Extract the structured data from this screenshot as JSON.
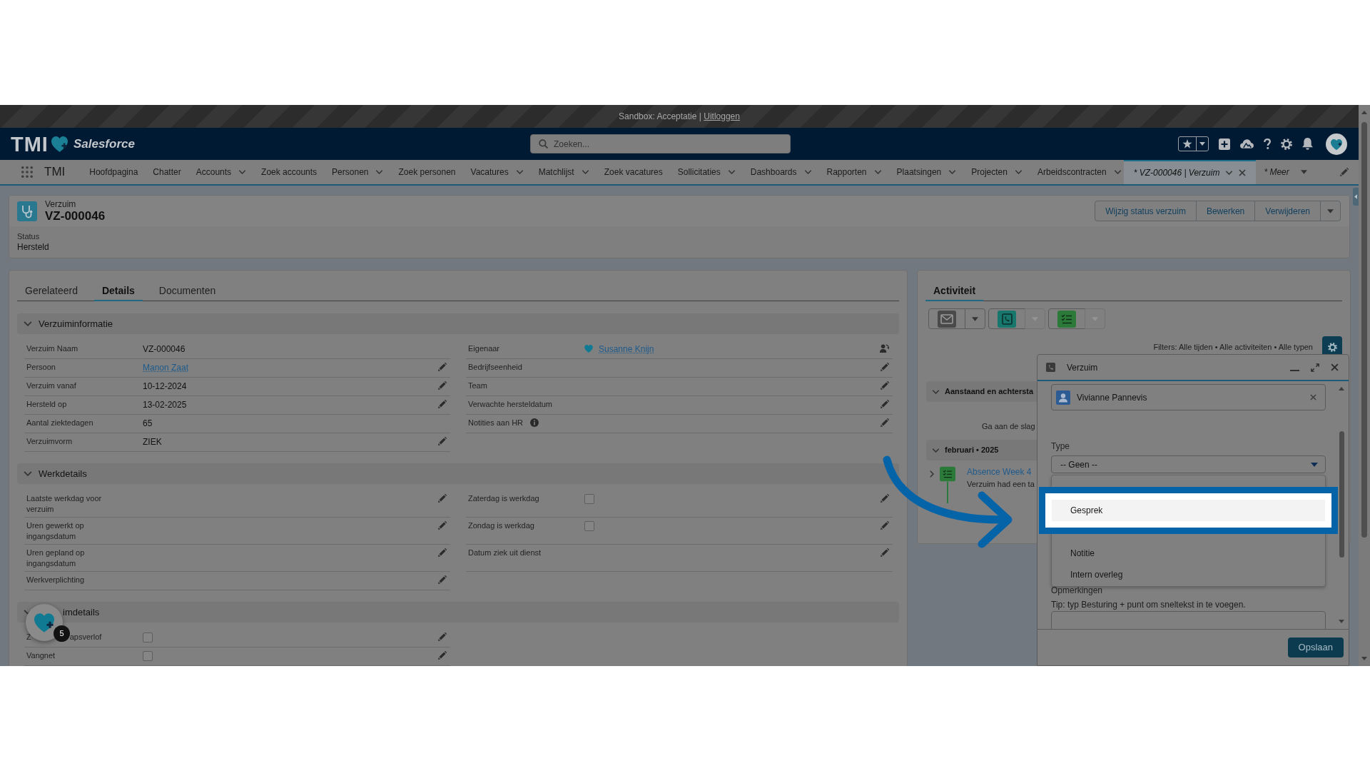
{
  "sandbox_bar": {
    "text": "Sandbox: Acceptatie |",
    "link": "Uitloggen"
  },
  "header": {
    "logo": "TMI",
    "product": "Salesforce",
    "search": {
      "placeholder": "Zoeken..."
    }
  },
  "nav": {
    "app_name": "TMI",
    "items": [
      {
        "label": "Hoofdpagina",
        "kind": "app",
        "dropdown": false,
        "selected": false
      },
      {
        "label": "Chatter",
        "kind": "app",
        "dropdown": false,
        "selected": false
      },
      {
        "label": "Accounts",
        "kind": "app",
        "dropdown": true,
        "selected": false
      },
      {
        "label": "Zoek accounts",
        "kind": "app",
        "dropdown": false,
        "selected": false
      },
      {
        "label": "Personen",
        "kind": "app",
        "dropdown": true,
        "selected": false
      },
      {
        "label": "Zoek personen",
        "kind": "app",
        "dropdown": false,
        "selected": false
      },
      {
        "label": "Vacatures",
        "kind": "app",
        "dropdown": true,
        "selected": false
      },
      {
        "label": "Matchlijst",
        "kind": "app",
        "dropdown": true,
        "selected": false
      },
      {
        "label": "Zoek vacatures",
        "kind": "app",
        "dropdown": false,
        "selected": false
      },
      {
        "label": "Sollicitaties",
        "kind": "app",
        "dropdown": true,
        "selected": false
      },
      {
        "label": "Dashboards",
        "kind": "app",
        "dropdown": true,
        "selected": false
      },
      {
        "label": "Rapporten",
        "kind": "app",
        "dropdown": true,
        "selected": false
      },
      {
        "label": "Plaatsingen",
        "kind": "app",
        "dropdown": true,
        "selected": false
      },
      {
        "label": "Projecten",
        "kind": "app",
        "dropdown": true,
        "selected": false
      },
      {
        "label": "Arbeidscontracten",
        "kind": "app",
        "dropdown": true,
        "selected": false
      },
      {
        "label": "* VZ-000046 | Verzuim",
        "kind": "record",
        "dropdown": true,
        "selected": true
      },
      {
        "label": "* Meer",
        "kind": "more",
        "dropdown": true,
        "selected": false
      }
    ]
  },
  "record": {
    "object": "Verzuim",
    "name": "VZ-000046",
    "actions": [
      "Wijzig status verzuim",
      "Bewerken",
      "Verwijderen"
    ],
    "highlights": [
      {
        "label": "Status",
        "value": "Hersteld"
      }
    ]
  },
  "detail_tabs": [
    {
      "label": "Gerelateerd",
      "selected": false
    },
    {
      "label": "Details",
      "selected": true
    },
    {
      "label": "Documenten",
      "selected": false
    }
  ],
  "sections": [
    {
      "title": "Verzuiminformatie",
      "expanded": true,
      "covered": false,
      "left": [
        {
          "label": "Verzuim Naam",
          "kind": "text",
          "value": "VZ-000046",
          "editable": false,
          "help": false
        },
        {
          "label": "Persoon",
          "kind": "link",
          "value": "Manon Zaat",
          "editable": true,
          "help": false
        },
        {
          "label": "Verzuim vanaf",
          "kind": "text",
          "value": "10-12-2024",
          "editable": true,
          "help": false
        },
        {
          "label": "Hersteld op",
          "kind": "text",
          "value": "13-02-2025",
          "editable": true,
          "help": false
        },
        {
          "label": "Aantal ziektedagen",
          "kind": "text",
          "value": "65",
          "editable": false,
          "help": false
        },
        {
          "label": "Verzuimvorm",
          "kind": "text",
          "value": "ZIEK",
          "editable": true,
          "help": false
        }
      ],
      "right": [
        {
          "label": "Eigenaar",
          "kind": "owner",
          "value": "Susanne Knijn",
          "editable": true,
          "help": false
        },
        {
          "label": "Bedrijfseenheid",
          "kind": "text",
          "editable": true,
          "help": false
        },
        {
          "label": "Team",
          "kind": "text",
          "editable": true,
          "help": false
        },
        {
          "label": "Verwachte hersteldatum",
          "kind": "text",
          "editable": true,
          "help": false
        },
        {
          "label": "Notities aan HR",
          "kind": "text",
          "editable": true,
          "help": true
        }
      ]
    },
    {
      "title": "Werkdetails",
      "expanded": true,
      "covered": false,
      "left": [
        {
          "label": "Laatste werkdag voor verzuim",
          "kind": "text",
          "editable": true,
          "help": false
        },
        {
          "label": "Uren gewerkt op ingangsdatum",
          "kind": "text",
          "editable": true,
          "help": false
        },
        {
          "label": "Uren gepland op ingangsdatum",
          "kind": "text",
          "editable": true,
          "help": false
        },
        {
          "label": "Werkverplichting",
          "kind": "text",
          "editable": true,
          "help": false
        }
      ],
      "right": [
        {
          "label": "Zaterdag is werkdag",
          "kind": "checkbox",
          "checked": false,
          "editable": true,
          "help": false
        },
        {
          "label": "Zondag is werkdag",
          "kind": "checkbox",
          "checked": false,
          "editable": true,
          "help": false
        },
        {
          "label": "Datum ziek uit dienst",
          "kind": "text",
          "editable": true,
          "help": false
        }
      ]
    },
    {
      "title": "imdetails",
      "expanded": true,
      "covered": true,
      "left": [
        {
          "label_parts": [
            "Z",
            "apsverlof"
          ],
          "kind": "checkbox",
          "checked": false,
          "editable": true,
          "help": false
        },
        {
          "label": "Vangnet",
          "kind": "checkbox",
          "checked": false,
          "editable": true,
          "help": false
        }
      ]
    }
  ],
  "activity": {
    "tabs": [
      {
        "label": "Activiteit",
        "selected": true
      }
    ],
    "actions": [
      {
        "kind": "email",
        "menu_disabled": false
      },
      {
        "kind": "call",
        "menu_disabled": true
      },
      {
        "kind": "task",
        "menu_disabled": true
      }
    ],
    "filters": "Filters: Alle tijden • Alle activiteiten • Alle typen",
    "groups": [
      {
        "title": "Aanstaand en achtersta",
        "expanded": true,
        "empty_text": "Ga aan de slag"
      },
      {
        "title": "februari • 2025",
        "expanded": true,
        "items": [
          {
            "kind": "task",
            "title": "Absence Week 4",
            "text": "Verzuim had een ta",
            "expanded": false
          }
        ]
      }
    ]
  },
  "composer": {
    "title": "Verzuim",
    "contact": "Vivianne Pannevis",
    "type": {
      "label": "Type",
      "value": "-- Geen --",
      "options": [
        {
          "label": "Gesprek",
          "selected": true
        },
        {
          "label": "Notitie",
          "selected": false
        },
        {
          "label": "Intern overleg",
          "selected": false
        }
      ]
    },
    "remarks": {
      "label": "Opmerkingen",
      "tip": "Tip: typ Besturing + punt om sneltekst in te voegen."
    },
    "save": "Opslaan"
  },
  "floating_button": {
    "badge": "5"
  }
}
